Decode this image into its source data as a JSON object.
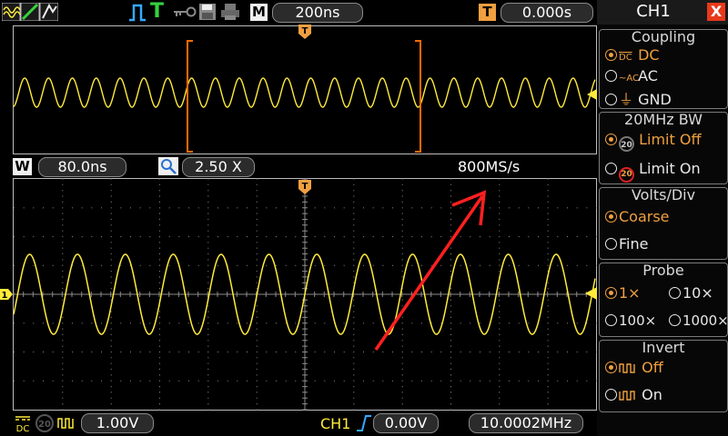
{
  "top_bar": {
    "icons": [
      "wave-mode-icon",
      "roll-mode-icon",
      "persist-mode-icon",
      "pulse-trigger-icon",
      "trigger-mode-icon",
      "key-lock-icon",
      "save-icon",
      "print-icon"
    ],
    "t_label": "T",
    "m_label": "M",
    "timebase": "200ns",
    "trigger_tag": "T",
    "trigger_position": "0.000s"
  },
  "window_bar": {
    "w_label": "W",
    "window_time": "80.0ns",
    "zoom": "2.50 X",
    "sample_rate": "800MS/s"
  },
  "markers": {
    "trigger_marker": "T",
    "channel_marker": "1"
  },
  "bottom_bar": {
    "coupling_symbol": "DC",
    "bw_symbol": "20",
    "ch1_volts": "1.00V",
    "trigger_channel": "CH1",
    "trigger_level": "0.00V",
    "frequency": "10.0002MHz"
  },
  "panel": {
    "title": "CH1",
    "close": "X",
    "coupling": {
      "title": "Coupling",
      "options": [
        "DC",
        "AC",
        "GND"
      ],
      "selected": 0
    },
    "bandwidth": {
      "title": "20MHz BW",
      "options": [
        "Limit Off",
        "Limit On"
      ],
      "selected": 0
    },
    "volts_div": {
      "title": "Volts/Div",
      "options": [
        "Coarse",
        "Fine"
      ],
      "selected": 0
    },
    "probe": {
      "title": "Probe",
      "options": [
        "1×",
        "10×",
        "100×",
        "1000×"
      ],
      "selected": 0
    },
    "invert": {
      "title": "Invert",
      "options": [
        "Off",
        "On"
      ],
      "selected": 0
    }
  },
  "colors": {
    "trace": "#ffeb3b",
    "accent": "#f0a040",
    "window_bracket": "#ff6a00",
    "annotation_arrow": "#ff2020",
    "close_button": "#e8391b"
  }
}
